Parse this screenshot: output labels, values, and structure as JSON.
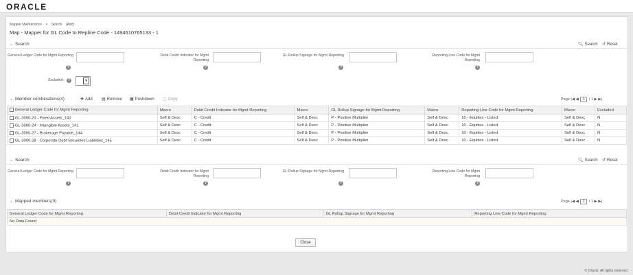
{
  "brand": {
    "logo_text": "ORACLE"
  },
  "breadcrumb": {
    "items": [
      "Mapper Maintenance",
      ">",
      "Search",
      "(Add)"
    ]
  },
  "page_title": "Map - Mapper for GL Code to Repline Code - 1494610765133 - 1",
  "search1": {
    "header": "Search",
    "search_label": "Search",
    "reset_label": "Reset",
    "fields": [
      {
        "label": "General Ledger Code for Mgmt Reporting",
        "value": ""
      },
      {
        "label": "Debit Credit Indicator for Mgmt Reporting",
        "value": ""
      },
      {
        "label": "GL Rollup Signage for Mgmt Reporting",
        "value": ""
      },
      {
        "label": "Reporting Line Code for Mgmt Reporting",
        "value": ""
      }
    ],
    "excluded_label": "Excluded:",
    "excluded_value": ""
  },
  "member_combinations": {
    "header": "Member combinations(4)",
    "toolbar": {
      "add": "Add",
      "remove": "Remove",
      "pushdown": "Pushdown",
      "copy": "Copy"
    },
    "pager": {
      "page_label": "Page",
      "current": "1",
      "total": "/ 1"
    },
    "columns": [
      "General Ledger Code for Mgmt Reporting",
      "Macro",
      "Debit Credit Indicator for Mgmt Reporting",
      "Macro",
      "GL Rollup Signage for Mgmt Reporting",
      "Macro",
      "Reporting Line Code for Mgmt Reporting",
      "Macro",
      "Excluded"
    ],
    "rows": [
      [
        "GL-3000-23 - Fixed Assets_140",
        "Self & Desc",
        "C - Credit",
        "Self & Desc",
        "P - Positive Multiplier",
        "Self & Desc",
        "10 - Equities - Listed",
        "Self & Desc",
        "N"
      ],
      [
        "GL-3000-24 - Intangible Assets_141",
        "Self & Desc",
        "C - Credit",
        "Self & Desc",
        "P - Positive Multiplier",
        "Self & Desc",
        "10 - Equities - Listed",
        "Self & Desc",
        "N"
      ],
      [
        "GL-3000-27 - Brokerage Payable_144",
        "Self & Desc",
        "C - Credit",
        "Self & Desc",
        "P - Positive Multiplier",
        "Self & Desc",
        "10 - Equities - Listed",
        "Self & Desc",
        "N"
      ],
      [
        "GL-3000-28 - Corporate Debt Securities Liabilities_145",
        "Self & Desc",
        "C - Credit",
        "Self & Desc",
        "P - Positive Multiplier",
        "Self & Desc",
        "10 - Equities - Listed",
        "Self & Desc",
        "N"
      ]
    ]
  },
  "search2": {
    "header": "Search",
    "search_label": "Search",
    "reset_label": "Reset",
    "fields": [
      {
        "label": "General Ledger Code for Mgmt Reporting",
        "value": ""
      },
      {
        "label": "Debit Credit Indicator for Mgmt Reporting",
        "value": ""
      },
      {
        "label": "GL Rollup Signage for Mgmt Reporting",
        "value": ""
      },
      {
        "label": "Reporting Line Code for Mgmt Reporting",
        "value": ""
      }
    ]
  },
  "mapped_members": {
    "header": "Mapped members(0)",
    "pager": {
      "page_label": "Page",
      "current": "1",
      "total": "/ 1"
    },
    "columns": [
      "General Ledger Code for Mgmt Reporting",
      "Debit Credit Indicator for Mgmt Reporting",
      "GL Rollup Signage for Mgmt Reporting",
      "Reporting Line Code for Mgmt Reporting"
    ],
    "empty_text": "No Data Found"
  },
  "close_label": "Close",
  "footer": "© Oracle. All rights reserved",
  "icons": {
    "search": "search-icon",
    "reset": "reset-icon",
    "help": "help-icon",
    "add": "add-icon",
    "remove": "remove-icon",
    "pushdown": "pushdown-icon",
    "copy": "copy-icon",
    "chevron": "chevron-down-icon",
    "first": "first-page-icon",
    "prev": "prev-page-icon",
    "next": "next-page-icon",
    "last": "last-page-icon",
    "close": "close-icon"
  }
}
